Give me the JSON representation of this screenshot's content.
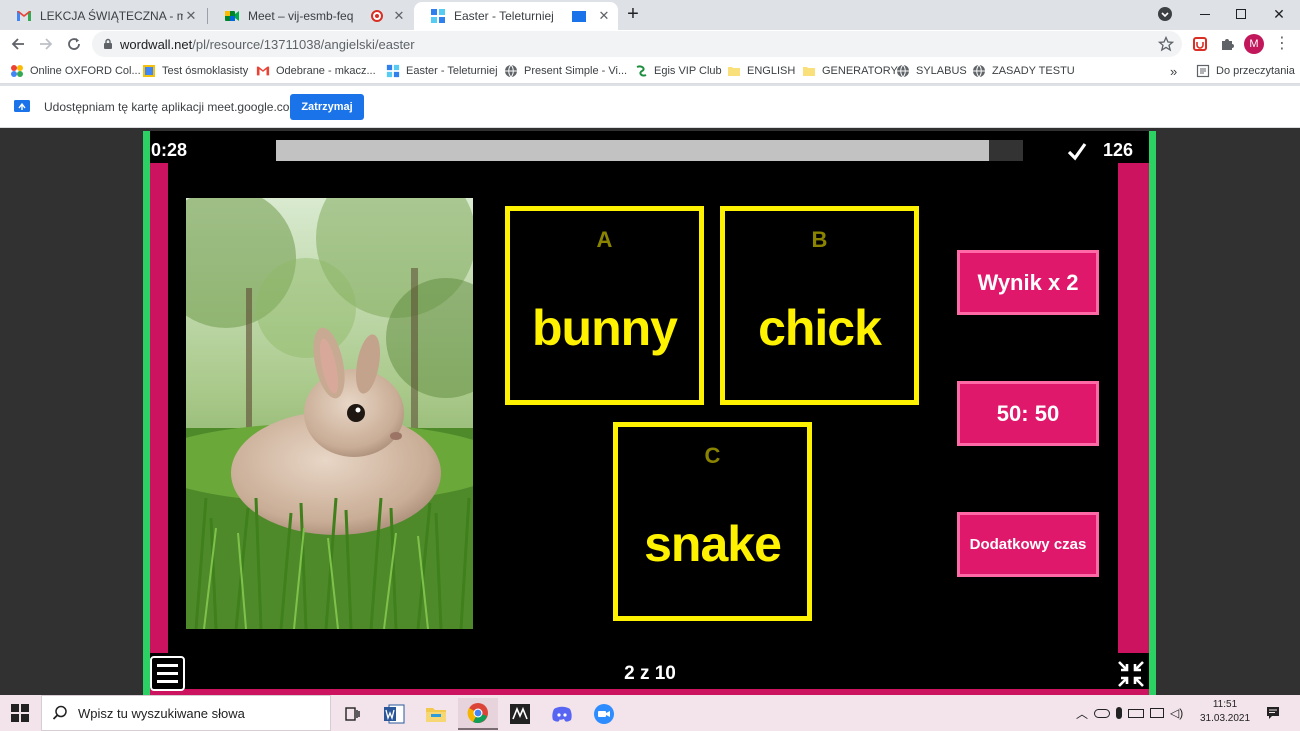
{
  "browser": {
    "tabs": [
      {
        "title": "LEKCJA ŚWIĄTECZNA - mkaczma",
        "icon": "gmail-icon",
        "active": false
      },
      {
        "title": "Meet – vij-esmb-feq",
        "icon": "meet-icon",
        "active": false
      },
      {
        "title": "Easter - Teleturniej",
        "icon": "wordwall-icon",
        "active": true
      }
    ],
    "new_tab": "+",
    "url_host": "wordwall.net",
    "url_path": "/pl/resource/13711038/angielski/easter",
    "profile_initial": "M"
  },
  "bookmarks": {
    "items": [
      {
        "label": "Online OXFORD Col..."
      },
      {
        "label": "Test ósmoklasisty"
      },
      {
        "label": "Odebrane - mkacz..."
      },
      {
        "label": "Easter - Teleturniej"
      },
      {
        "label": "Present Simple - Vi..."
      },
      {
        "label": "Egis VIP Club"
      },
      {
        "label": "ENGLISH"
      },
      {
        "label": "GENERATORY"
      },
      {
        "label": "SYLABUS"
      },
      {
        "label": "ZASADY TESTU"
      }
    ],
    "overflow": "»",
    "reading_list": "Do przeczytania"
  },
  "infobar": {
    "text": "Udostępniam tę kartę aplikacji meet.google.com",
    "button": "Zatrzymaj"
  },
  "game": {
    "timer": "0:28",
    "progress_fraction": 0.955,
    "score": "126",
    "answers": [
      {
        "letter": "A",
        "word": "bunny"
      },
      {
        "letter": "B",
        "word": "chick"
      },
      {
        "letter": "C",
        "word": "snake"
      }
    ],
    "powerups": [
      "Wynik x 2",
      "50: 50",
      "Dodatkowy czas"
    ],
    "page_counter": "2 z 10",
    "colors": {
      "accent": "#fff200",
      "frame": "#cc135f",
      "green": "#2bd162",
      "powerup": "#e0186c"
    }
  },
  "taskbar": {
    "search_placeholder": "Wpisz tu wyszukiwane słowa",
    "time": "11:51",
    "date": "31.03.2021"
  }
}
